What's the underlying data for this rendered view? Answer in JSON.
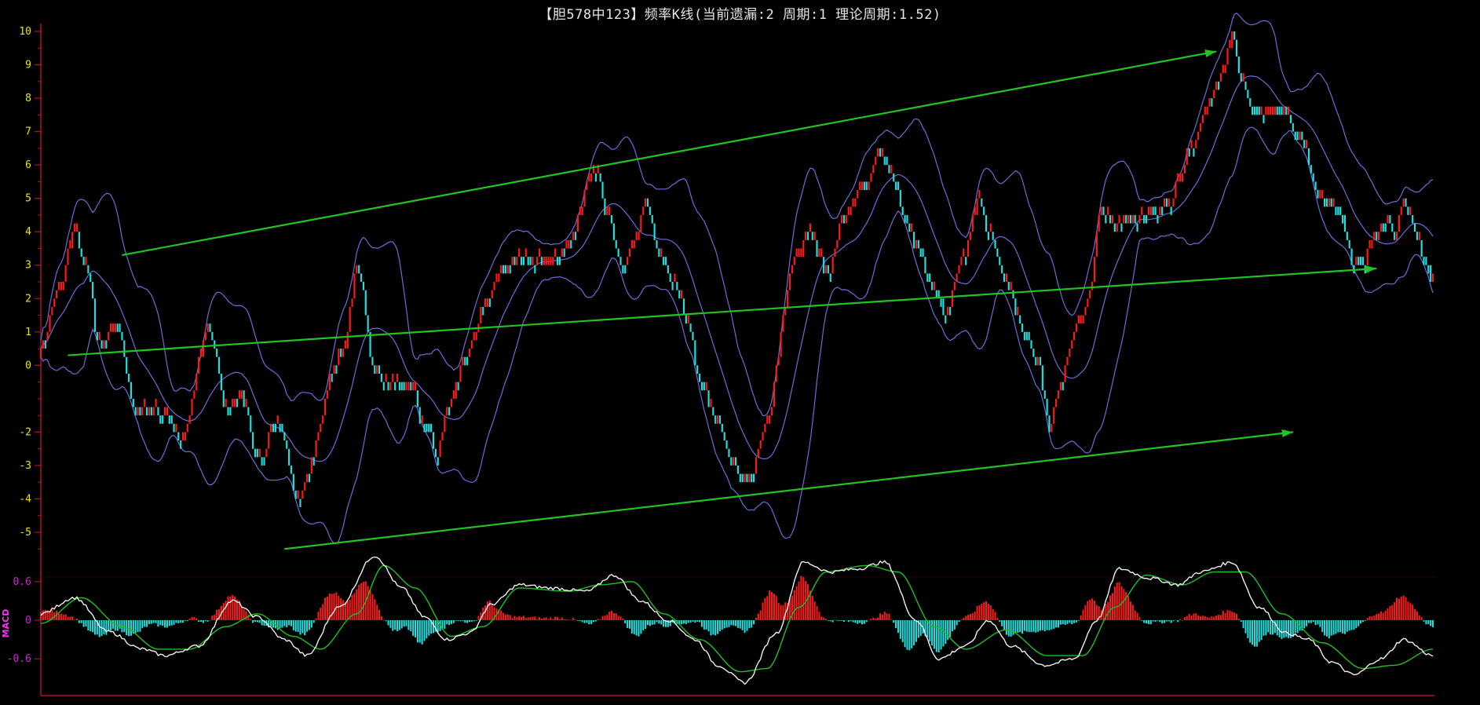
{
  "title": "【胆578中123】频率K线(当前遗漏:2 周期:1 理论周期:1.52)",
  "colors": {
    "background": "#000000",
    "axis": "#b0102a",
    "up_candle": "#ff1a1a",
    "down_candle": "#20e0e0",
    "band": "#6c6cd8",
    "trend_arrow": "#22c322",
    "macd_dif": "#f0f0f0",
    "macd_dea": "#20c020",
    "macd_pos": "#ff1a1a",
    "macd_neg": "#20e0e0",
    "ytick": "#e8e800",
    "macd_tick": "#d020d0"
  },
  "chart_data": [
    {
      "type": "candlestick",
      "title": "【胆578中123】频率K线(当前遗漏:2 周期:1 理论周期:1.52)",
      "ylim": [
        -5.5,
        10.2
      ],
      "yticks": [
        10,
        9,
        8,
        7,
        6,
        5,
        4,
        3,
        2,
        1,
        0,
        -2,
        -3,
        -4,
        -5
      ],
      "ytick_labels": [
        "10",
        "9",
        "8",
        "7",
        "6",
        "5",
        "4",
        "3",
        "2",
        "1",
        "0",
        "-2",
        "-3",
        "-4",
        "-5"
      ],
      "n_candles": 294,
      "close_keypoints": [
        [
          0,
          0.6
        ],
        [
          8,
          2.3
        ],
        [
          15,
          4.0
        ],
        [
          20,
          3.0
        ],
        [
          26,
          0.6
        ],
        [
          34,
          1.2
        ],
        [
          42,
          -1.3
        ],
        [
          55,
          -1.4
        ],
        [
          62,
          -2.3
        ],
        [
          74,
          1.0
        ],
        [
          83,
          -1.3
        ],
        [
          89,
          -0.9
        ],
        [
          97,
          -2.9
        ],
        [
          104,
          -1.5
        ],
        [
          114,
          -3.8
        ],
        [
          134,
          0.5
        ],
        [
          140,
          2.9
        ],
        [
          148,
          0.0
        ],
        [
          154,
          -0.5
        ],
        [
          165,
          -0.7
        ],
        [
          169,
          -2.0
        ],
        [
          172,
          -1.7
        ],
        [
          175,
          -3.0
        ],
        [
          181,
          -1.2
        ],
        [
          188,
          0.2
        ],
        [
          198,
          2.0
        ],
        [
          204,
          2.9
        ],
        [
          212,
          3.2
        ],
        [
          226,
          3.1
        ],
        [
          232,
          3.5
        ],
        [
          246,
          5.9
        ],
        [
          251,
          4.5
        ],
        [
          257,
          3.0
        ],
        [
          263,
          3.6
        ],
        [
          268,
          4.9
        ],
        [
          274,
          3.3
        ],
        [
          281,
          2.4
        ],
        [
          287,
          1.2
        ],
        [
          293,
          -0.7
        ],
        [
          299,
          -1.6
        ],
        [
          309,
          -3.2
        ],
        [
          315,
          -3.3
        ]
      ],
      "close_keypoints_2": [
        [
          320,
          -2.0
        ],
        [
          334,
          3.0
        ],
        [
          340,
          4.0
        ],
        [
          349,
          2.8
        ],
        [
          356,
          4.5
        ],
        [
          365,
          5.4
        ],
        [
          372,
          6.5
        ],
        [
          378,
          5.6
        ],
        [
          383,
          4.3
        ],
        [
          388,
          3.6
        ],
        [
          397,
          2.1
        ],
        [
          401,
          1.5
        ],
        [
          408,
          3.2
        ],
        [
          416,
          4.9
        ],
        [
          421,
          3.8
        ],
        [
          428,
          2.4
        ],
        [
          436,
          1.0
        ],
        [
          442,
          0.2
        ],
        [
          447,
          -1.8
        ],
        [
          452,
          -0.6
        ],
        [
          457,
          0.8
        ],
        [
          464,
          2.0
        ],
        [
          470,
          4.7
        ],
        [
          478,
          4.2
        ],
        [
          490,
          4.5
        ],
        [
          500,
          4.9
        ],
        [
          510,
          6.5
        ],
        [
          518,
          7.8
        ],
        [
          524,
          8.8
        ],
        [
          528,
          9.9
        ],
        [
          532,
          8.6
        ],
        [
          537,
          7.8
        ],
        [
          542,
          7.5
        ],
        [
          549,
          7.7
        ],
        [
          558,
          6.9
        ],
        [
          567,
          5.0
        ],
        [
          575,
          4.7
        ],
        [
          581,
          3.2
        ],
        [
          586,
          3.0
        ],
        [
          590,
          3.7
        ],
        [
          596,
          4.4
        ],
        [
          600,
          3.8
        ],
        [
          604,
          5.0
        ],
        [
          608,
          4.3
        ],
        [
          612,
          3.5
        ],
        [
          617,
          2.4
        ]
      ],
      "bollinger_bands": {
        "upper": "purple line above",
        "middle": "purple moving average",
        "lower": "purple line below"
      },
      "annotations": [
        {
          "type": "trend_arrow",
          "from": [
            36,
            3.3
          ],
          "to": [
            521,
            9.4
          ]
        },
        {
          "type": "trend_arrow",
          "from": [
            12,
            0.3
          ],
          "to": [
            592,
            2.9
          ]
        },
        {
          "type": "trend_arrow",
          "from": [
            108,
            -5.5
          ],
          "to": [
            555,
            -2.0
          ]
        }
      ]
    },
    {
      "type": "macd",
      "label": "MACD",
      "ylim": [
        -0.95,
        1.05
      ],
      "yticks": [
        0.6,
        0,
        -0.6
      ],
      "ytick_labels": [
        "0.6",
        "0",
        "-0.6"
      ],
      "dif_keypoints": [
        [
          0,
          0.1
        ],
        [
          15,
          0.35
        ],
        [
          30,
          -0.18
        ],
        [
          45,
          -0.45
        ],
        [
          55,
          -0.55
        ],
        [
          70,
          -0.4
        ],
        [
          85,
          0.3
        ],
        [
          96,
          0.05
        ],
        [
          108,
          -0.3
        ],
        [
          118,
          -0.55
        ],
        [
          132,
          0.2
        ],
        [
          148,
          1.0
        ],
        [
          160,
          0.5
        ],
        [
          170,
          0.05
        ],
        [
          180,
          -0.3
        ],
        [
          190,
          -0.2
        ],
        [
          200,
          0.25
        ],
        [
          212,
          0.55
        ],
        [
          226,
          0.5
        ],
        [
          242,
          0.45
        ],
        [
          254,
          0.7
        ],
        [
          266,
          0.3
        ],
        [
          278,
          0.0
        ],
        [
          290,
          -0.3
        ],
        [
          300,
          -0.7
        ],
        [
          312,
          -0.97
        ],
        [
          326,
          -0.2
        ],
        [
          338,
          0.9
        ],
        [
          350,
          0.75
        ],
        [
          362,
          0.8
        ],
        [
          374,
          0.9
        ],
        [
          388,
          0.0
        ],
        [
          398,
          -0.6
        ],
        [
          410,
          -0.4
        ],
        [
          420,
          0.0
        ],
        [
          430,
          -0.4
        ],
        [
          445,
          -0.7
        ],
        [
          458,
          -0.6
        ],
        [
          468,
          0.0
        ],
        [
          478,
          0.8
        ],
        [
          492,
          0.65
        ],
        [
          504,
          0.55
        ],
        [
          514,
          0.75
        ],
        [
          528,
          0.9
        ],
        [
          540,
          0.2
        ],
        [
          552,
          -0.2
        ],
        [
          562,
          -0.3
        ],
        [
          572,
          -0.65
        ],
        [
          582,
          -0.85
        ],
        [
          594,
          -0.6
        ],
        [
          604,
          -0.3
        ],
        [
          617,
          -0.55
        ]
      ],
      "dea_keypoints": [
        [
          0,
          -0.05
        ],
        [
          18,
          0.35
        ],
        [
          36,
          -0.1
        ],
        [
          52,
          -0.45
        ],
        [
          66,
          -0.45
        ],
        [
          82,
          -0.1
        ],
        [
          96,
          0.1
        ],
        [
          112,
          -0.25
        ],
        [
          124,
          -0.45
        ],
        [
          140,
          0.1
        ],
        [
          152,
          0.85
        ],
        [
          166,
          0.5
        ],
        [
          182,
          -0.25
        ],
        [
          196,
          -0.1
        ],
        [
          212,
          0.5
        ],
        [
          234,
          0.45
        ],
        [
          248,
          0.55
        ],
        [
          262,
          0.6
        ],
        [
          276,
          0.1
        ],
        [
          292,
          -0.3
        ],
        [
          310,
          -0.8
        ],
        [
          322,
          -0.75
        ],
        [
          336,
          0.2
        ],
        [
          348,
          0.75
        ],
        [
          366,
          0.85
        ],
        [
          380,
          0.75
        ],
        [
          396,
          -0.1
        ],
        [
          410,
          -0.45
        ],
        [
          428,
          -0.15
        ],
        [
          446,
          -0.55
        ],
        [
          462,
          -0.55
        ],
        [
          476,
          0.2
        ],
        [
          490,
          0.7
        ],
        [
          506,
          0.55
        ],
        [
          520,
          0.75
        ],
        [
          534,
          0.75
        ],
        [
          550,
          0.1
        ],
        [
          568,
          -0.35
        ],
        [
          586,
          -0.75
        ],
        [
          600,
          -0.7
        ],
        [
          617,
          -0.45
        ]
      ]
    }
  ]
}
